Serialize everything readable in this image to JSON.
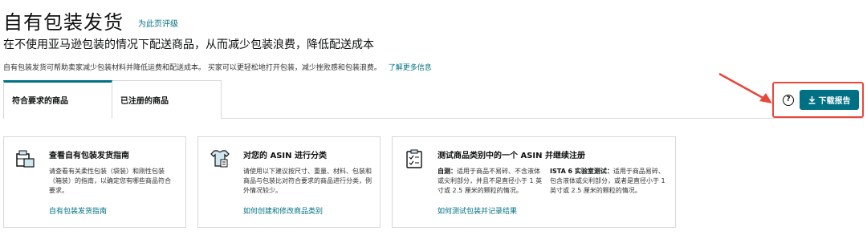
{
  "header": {
    "title": "自有包装发货",
    "rate_link": "为此页评级",
    "subtitle": "在不使用亚马逊包装的情况下配送商品，从而减少包装浪费，降低配送成本",
    "description": "自有包装发货可帮助卖家减少包装材料并降低运费和配送成本。 买家可以更轻松地打开包装，减少挫败感和包装浪费。",
    "learn_more": "了解更多信息"
  },
  "tabs": [
    {
      "label": "符合要求的商品",
      "active": true
    },
    {
      "label": "已注册的商品",
      "active": false
    }
  ],
  "actions": {
    "help_icon": "?",
    "download_label": "下载报告",
    "download_icon": "download-icon"
  },
  "colors": {
    "accent": "#007185",
    "highlight": "#e8473a"
  },
  "cards": [
    {
      "title": "查看自有包装发货指南",
      "text": "请查看有关柔性包装（袋装）和刚性包装（箱装）的指南，以确定您有哪些商品符合要求。",
      "link": "自有包装发货指南",
      "icon": "package-icon"
    },
    {
      "title": "对您的 ASIN 进行分类",
      "text": "请使用以下建议按尺寸、重量、材料、包装和商品与包装比对符合要求的商品进行分类，例外情况较少。",
      "link": "如何创建和修改商品类别",
      "icon": "clothing-icon"
    },
    {
      "title": "测试商品类别中的一个 ASIN 并继续注册",
      "col1_label": "自测：",
      "col1_text": "适用于商品不易碎、不含液体或尖利部分，并且不是直径小于 1 英寸或 2.5 厘米的颗粒的情况。",
      "col2_label": "ISTA 6 实验室测试：",
      "col2_text": "适用于商品易碎、包含液体或尖利部分，或者是直径小于 1 英寸或 2.5 厘米的颗粒的情况。",
      "link": "如何测试包装并记录结果",
      "icon": "clipboard-icon"
    }
  ]
}
